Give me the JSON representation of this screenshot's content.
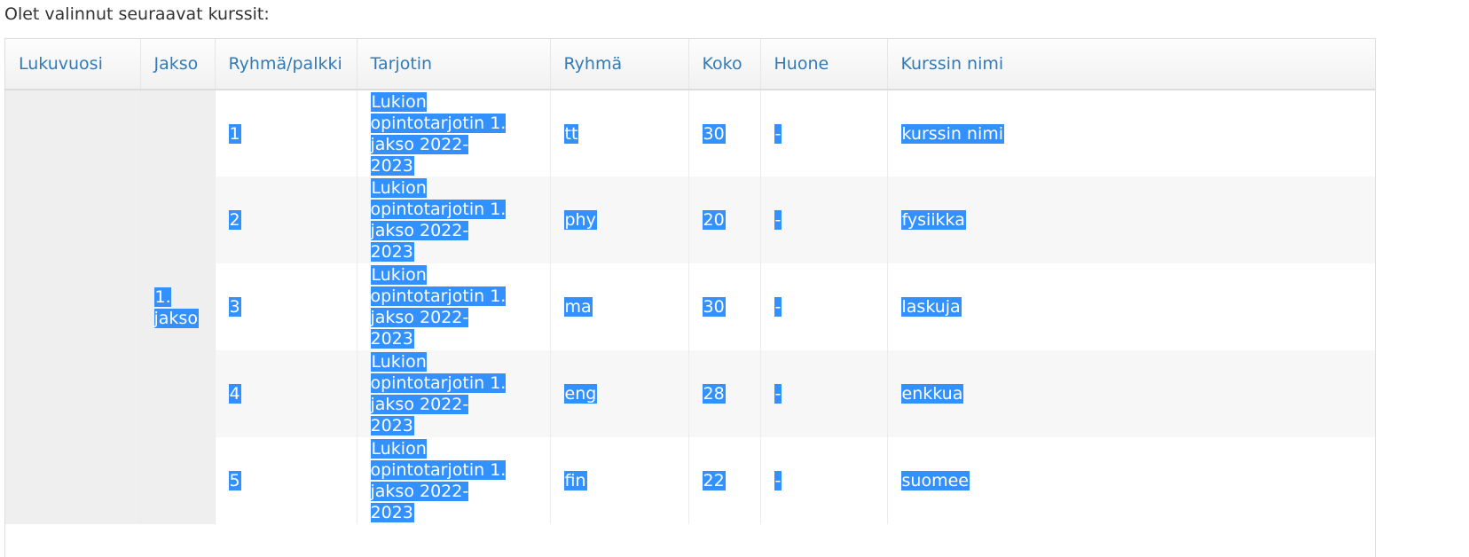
{
  "intro_text": "Olet valinnut seuraavat kurssit:",
  "table": {
    "headers": [
      "Lukuvuosi",
      "Jakso",
      "Ryhmä/palkki",
      "Tarjotin",
      "Ryhmä",
      "Koko",
      "Huone",
      "Kurssin nimi"
    ],
    "jakso_value": "1. jakso",
    "lukuvuosi_value": "",
    "rows": [
      {
        "palkki": "1",
        "tarjotin": "Lukion opintotarjotin 1. jakso 2022-2023",
        "ryhma": "tt",
        "koko": "30",
        "huone": "-",
        "kurssin_nimi": "kurssin nimi"
      },
      {
        "palkki": "2",
        "tarjotin": "Lukion opintotarjotin 1. jakso 2022-2023",
        "ryhma": "phy",
        "koko": "20",
        "huone": "-",
        "kurssin_nimi": "fysiikka"
      },
      {
        "palkki": "3",
        "tarjotin": "Lukion opintotarjotin 1. jakso 2022-2023",
        "ryhma": "ma",
        "koko": "30",
        "huone": "-",
        "kurssin_nimi": "laskuja"
      },
      {
        "palkki": "4",
        "tarjotin": "Lukion opintotarjotin 1. jakso 2022-2023",
        "ryhma": "eng",
        "koko": "28",
        "huone": "-",
        "kurssin_nimi": "enkkua"
      },
      {
        "palkki": "5",
        "tarjotin": "Lukion opintotarjotin 1. jakso 2022-2023",
        "ryhma": "fin",
        "koko": "22",
        "huone": "-",
        "kurssin_nimi": "suomee"
      }
    ]
  },
  "colors": {
    "header_text": "#337ab7",
    "selection": "#3390ff"
  }
}
